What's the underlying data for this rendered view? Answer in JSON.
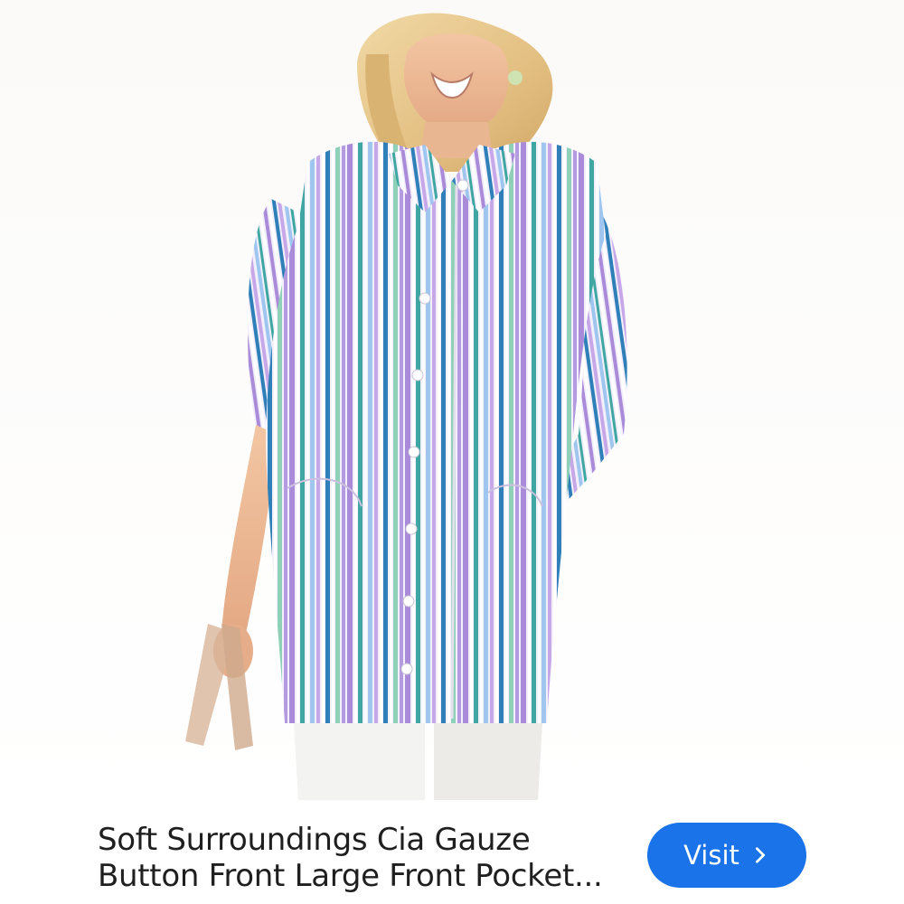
{
  "product": {
    "title_line1": "Soft Surroundings Cia Gauze",
    "title_line2": "Button Front Large Front Pocket...",
    "image_description_icon": "product-photo-icon"
  },
  "actions": {
    "visit_label": "Visit",
    "visit_icon": "chevron-right-icon"
  },
  "colors": {
    "accent": "#1a73e8",
    "title_text": "#1f1f1f",
    "background": "#ffffff"
  }
}
